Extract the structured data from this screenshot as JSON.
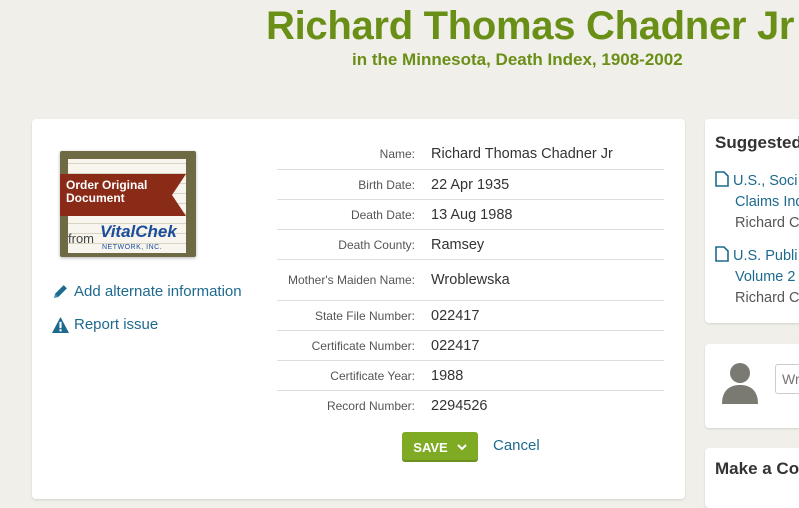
{
  "header": {
    "title": "Richard Thomas Chadner Jr",
    "subtitle": "in the Minnesota, Death Index, 1908-2002"
  },
  "order": {
    "ribbon_label": "Order Original Document",
    "from_label": "from",
    "brand": "VitalChek",
    "network": "NETWORK, INC."
  },
  "sidebar": {
    "add_alternate": "Add alternate information",
    "report_issue": "Report issue"
  },
  "details": [
    {
      "label": "Name:",
      "value": "Richard Thomas Chadner Jr"
    },
    {
      "label": "Birth Date:",
      "value": "22 Apr 1935"
    },
    {
      "label": "Death Date:",
      "value": "13 Aug 1988"
    },
    {
      "label": "Death County:",
      "value": "Ramsey"
    },
    {
      "label": "Mother's Maiden Name:",
      "value": "Wroblewska"
    },
    {
      "label": "State File Number:",
      "value": "022417"
    },
    {
      "label": "Certificate Number:",
      "value": "022417"
    },
    {
      "label": "Certificate Year:",
      "value": "1988"
    },
    {
      "label": "Record Number:",
      "value": "2294526"
    }
  ],
  "actions": {
    "save": "SAVE",
    "cancel": "Cancel"
  },
  "suggested": {
    "title": "Suggested",
    "items": [
      {
        "line1": "U.S., Soci",
        "line2": "Claims Ind",
        "sub": "Richard C"
      },
      {
        "line1": "U.S. Publi",
        "line2": "Volume 2",
        "sub": "Richard C"
      }
    ]
  },
  "comment": {
    "placeholder": "Wr"
  },
  "make_card": {
    "title": "Make a Co"
  },
  "colors": {
    "title_green": "#6a8f16",
    "link_blue": "#1e6a8e",
    "save_green": "#7faa24",
    "ribbon_red": "#8a2b17"
  }
}
